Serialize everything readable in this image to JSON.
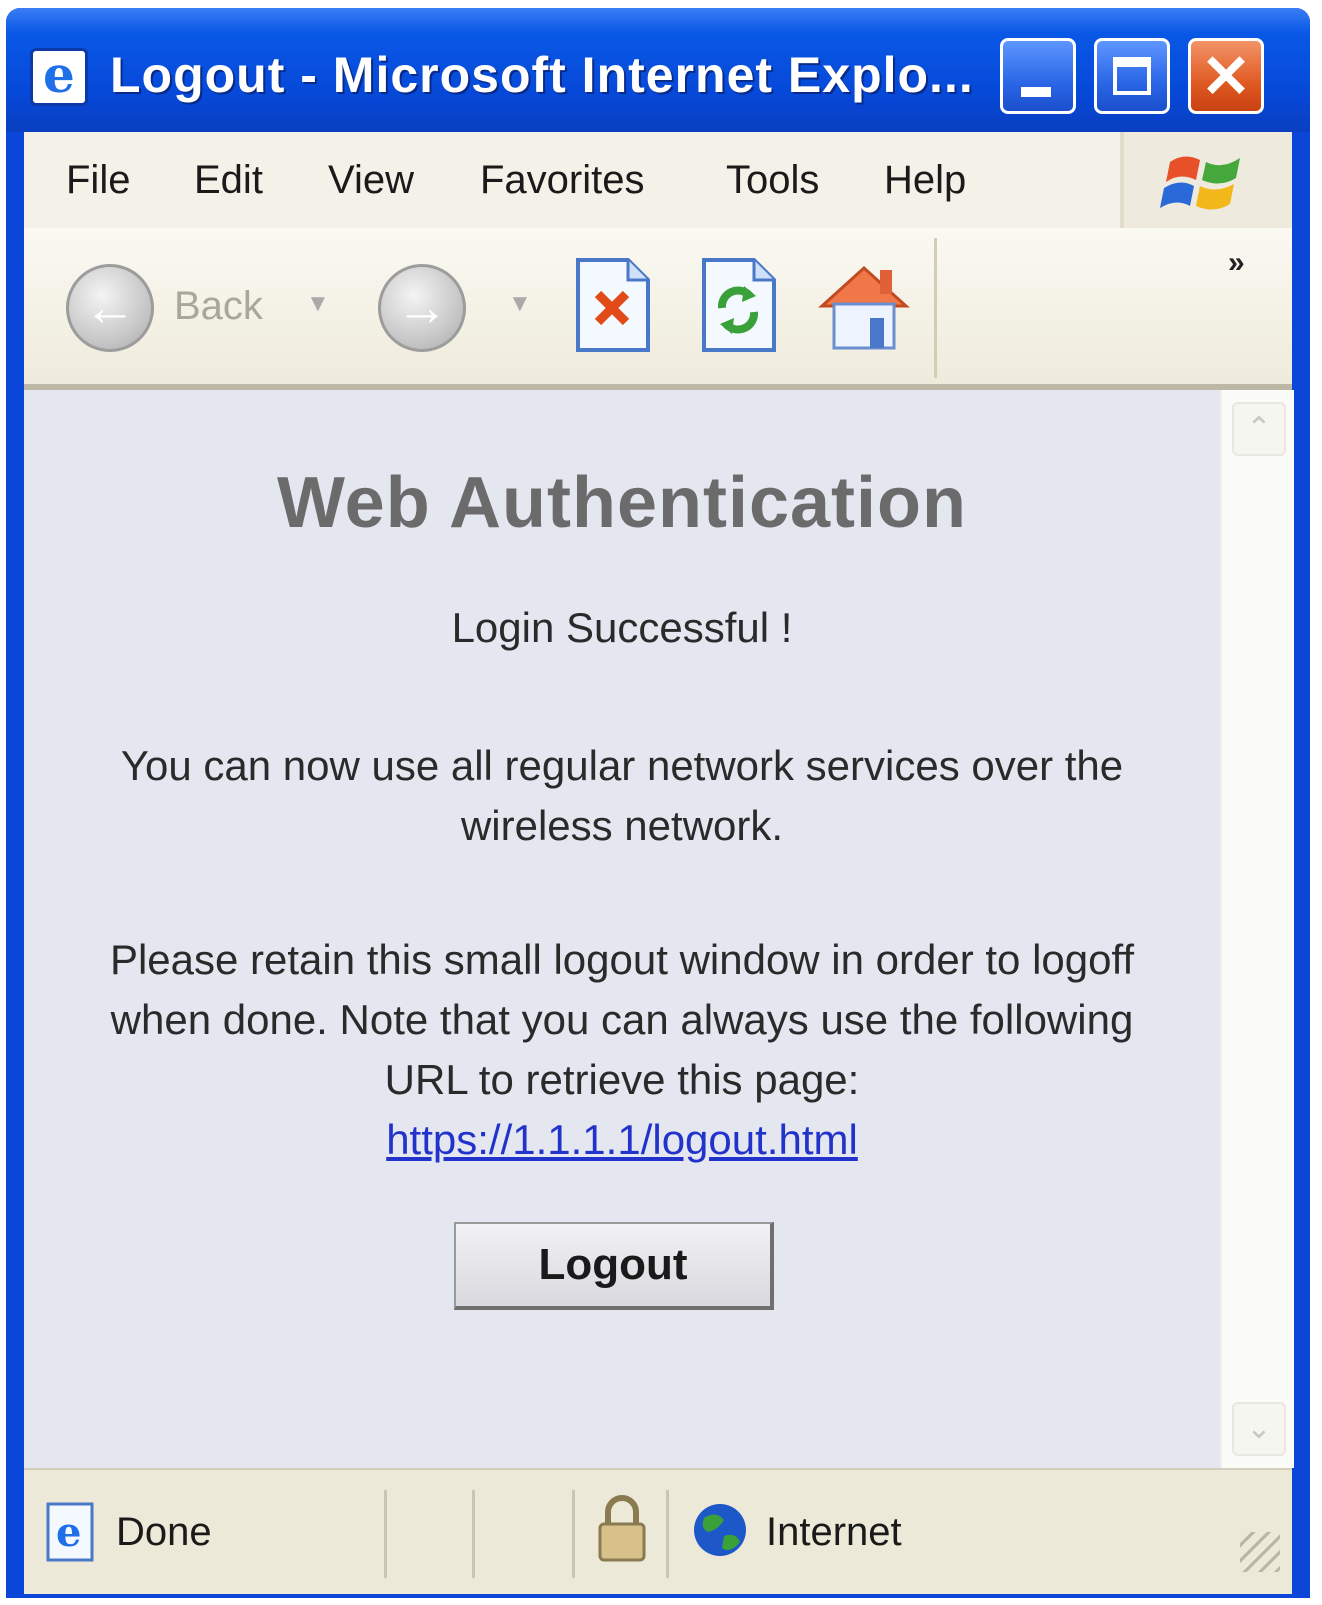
{
  "window": {
    "title": "Logout - Microsoft Internet Explo...",
    "controls": {
      "minimize": "minimize",
      "maximize": "maximize",
      "close": "✕"
    }
  },
  "menu": {
    "items": [
      {
        "label": "File"
      },
      {
        "label": "Edit"
      },
      {
        "label": "View"
      },
      {
        "label": "Favorites"
      },
      {
        "label": "Tools"
      },
      {
        "label": "Help"
      }
    ]
  },
  "toolbar": {
    "back_label": "Back",
    "overflow": "»",
    "icons": [
      "back-icon",
      "forward-icon",
      "stop-icon",
      "refresh-icon",
      "home-icon"
    ]
  },
  "page": {
    "heading": "Web Authentication",
    "status": "Login Successful !",
    "message": "You can now use all regular network services over the wireless network.",
    "instructions": "Please retain this small logout window in order to logoff when done. Note that you can always use the following URL to retrieve this page:",
    "url": "https://1.1.1.1/logout.html",
    "logout_button": "Logout"
  },
  "statusbar": {
    "status": "Done",
    "zone": "Internet"
  },
  "colors": {
    "titlebar": "#0a58e6",
    "content_bg": "#e4e6f0",
    "link": "#2233cc"
  }
}
